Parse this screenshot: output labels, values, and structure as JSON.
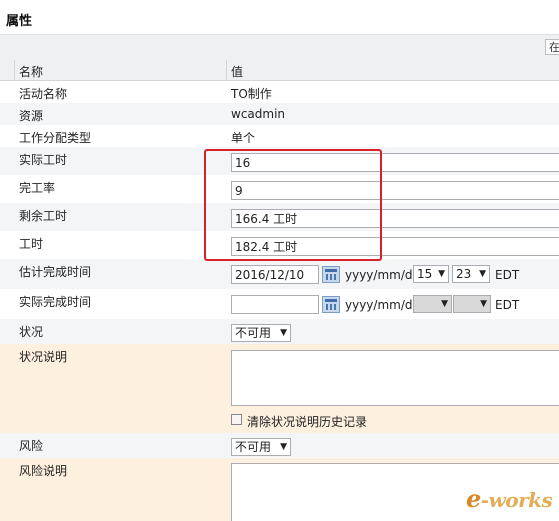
{
  "panel": {
    "title": "属性",
    "toolbar_button": "在"
  },
  "columns": {
    "name": "名称",
    "value": "值"
  },
  "rows": {
    "activity": {
      "label": "活动名称",
      "value": "TO制作"
    },
    "resource": {
      "label": "资源",
      "value": "wcadmin"
    },
    "assign_type": {
      "label": "工作分配类型",
      "value": "单个"
    },
    "actual_hours": {
      "label": "实际工时",
      "value": "16"
    },
    "completion": {
      "label": "完工率",
      "value": "9"
    },
    "remaining": {
      "label": "剩余工时",
      "value": "166.4 工时"
    },
    "hours": {
      "label": "工时",
      "value": "182.4 工时"
    },
    "est_finish": {
      "label": "估计完成时间",
      "date": "2016/12/10",
      "format": "yyyy/mm/dd",
      "hour": "15",
      "minute": "23",
      "tz": "EDT"
    },
    "act_finish": {
      "label": "实际完成时间",
      "date": "",
      "format": "yyyy/mm/dd",
      "hour": "",
      "minute": "",
      "tz": "EDT"
    },
    "status": {
      "label": "状况",
      "value": "不可用"
    },
    "status_note": {
      "label": "状况说明",
      "value": "",
      "clear_history": "清除状况说明历史记录"
    },
    "risk": {
      "label": "风险",
      "value": "不可用"
    },
    "risk_note": {
      "label": "风险说明",
      "value": ""
    }
  },
  "watermark": {
    "logo_e": "e",
    "logo_rest": "-works"
  },
  "colors": {
    "highlight_row": "#fdf0df",
    "alt_row": "#f4f5f7",
    "highlight_box": "#d6212b"
  }
}
